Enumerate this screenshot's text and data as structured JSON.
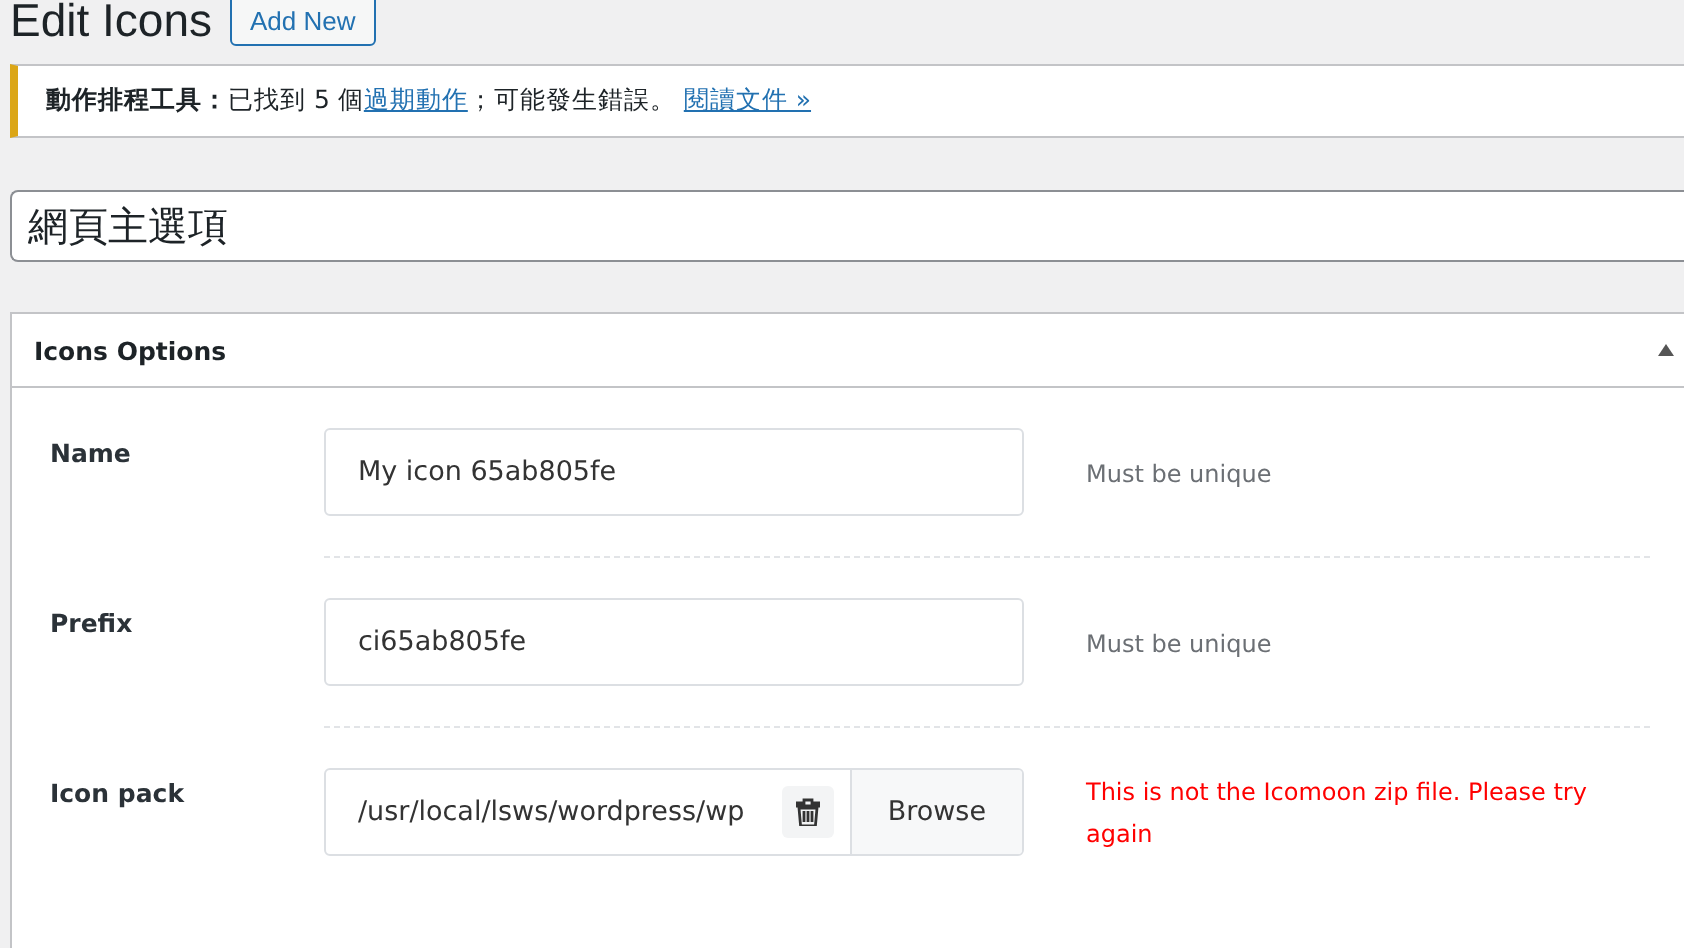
{
  "heading": {
    "title": "Edit Icons",
    "button": "Add New"
  },
  "notice": {
    "kind": "warning",
    "label": "動作排程工具：",
    "parts": [
      {
        "kind": "text",
        "text": "已找到 5 個"
      },
      {
        "kind": "link",
        "text": "過期動作"
      },
      {
        "kind": "text",
        "text": "；可能發生錯誤。 "
      },
      {
        "kind": "link",
        "text": "閱讀文件 »"
      }
    ]
  },
  "title_field": {
    "value": "網頁主選項"
  },
  "panel": {
    "title": "Icons Options",
    "expanded": true,
    "fields": [
      {
        "kind": "text",
        "label": "Name",
        "value": "My icon 65ab805fe",
        "help": "Must be unique",
        "error": false
      },
      {
        "kind": "text",
        "label": "Prefix",
        "value": "ci65ab805fe",
        "help": "Must be unique",
        "error": false
      },
      {
        "kind": "file",
        "label": "Icon pack",
        "value": "/usr/local/lsws/wordpress/wp",
        "button": "Browse",
        "help": "This is not the Icomoon zip file. Please try again",
        "error": true
      }
    ]
  }
}
